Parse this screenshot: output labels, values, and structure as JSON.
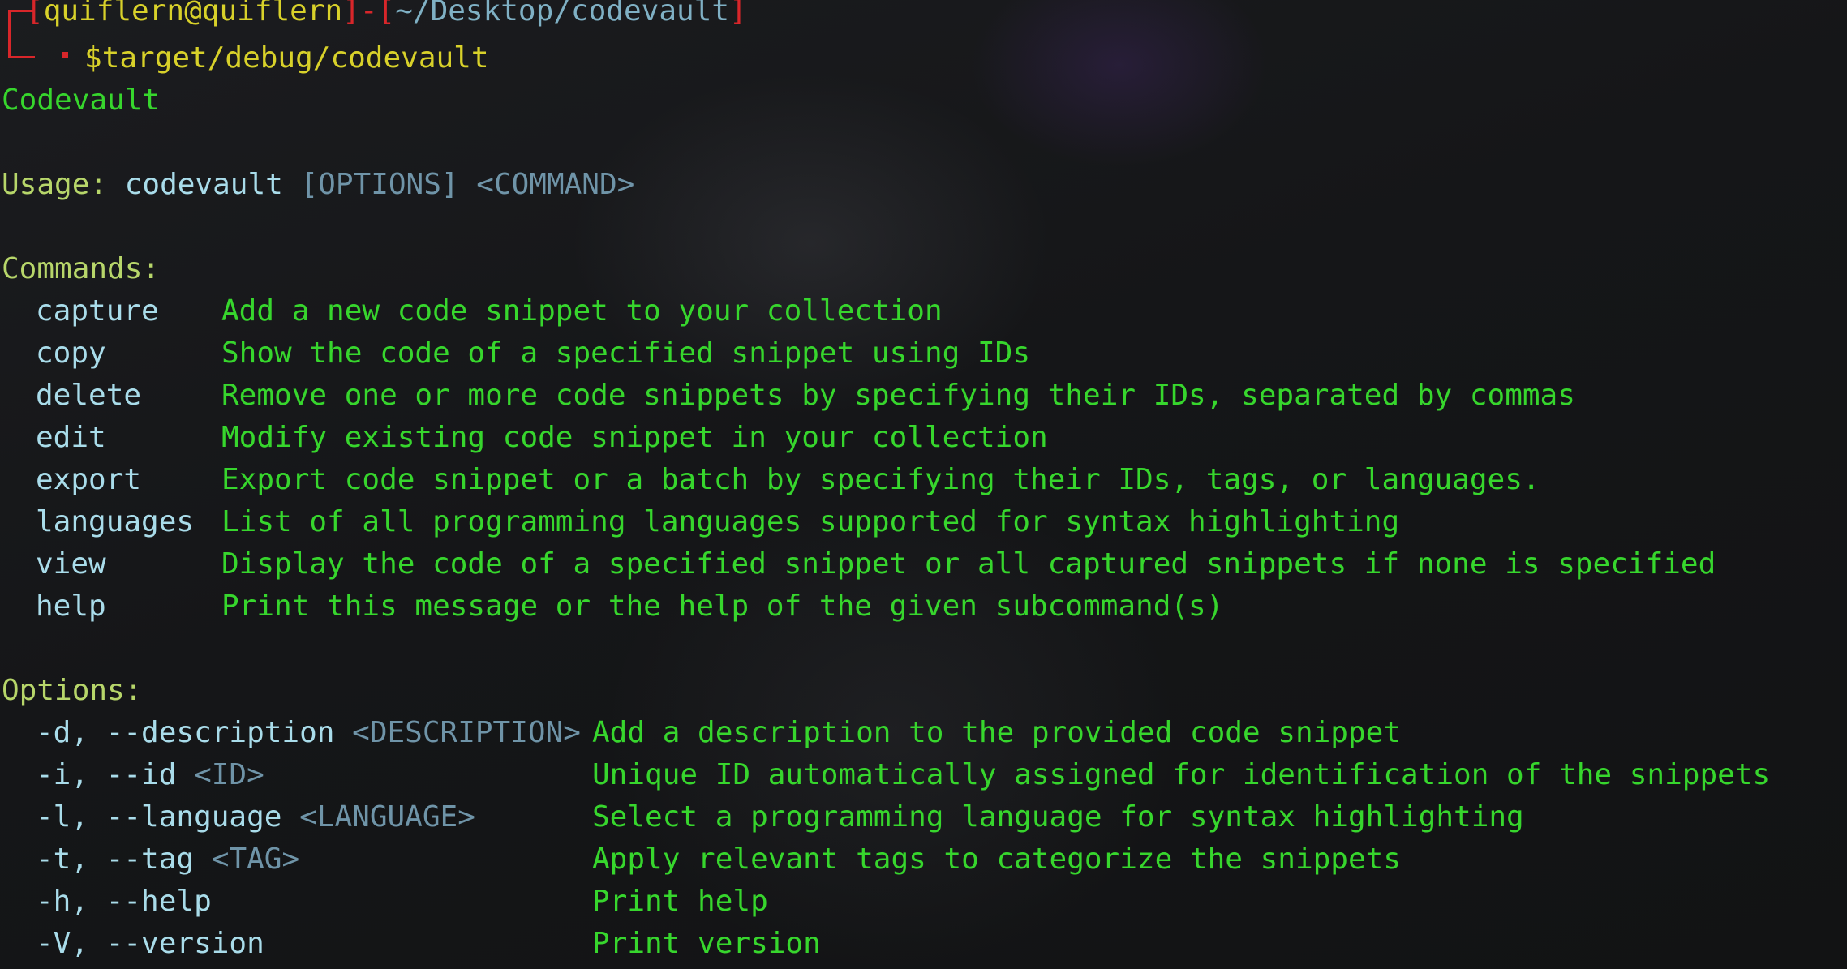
{
  "prompt": {
    "open_bracket": "[",
    "user": "quiflern",
    "at": "@",
    "host": "quiflern",
    "close_bracket": "]",
    "dash": "-",
    "path_open": "[",
    "path": "~/Desktop/codevault",
    "path_close": "]",
    "dollar": "$",
    "command": "target/debug/codevault"
  },
  "output": {
    "app_name": "Codevault",
    "usage_label": "Usage:",
    "usage_cmd": "codevault",
    "usage_options": "[OPTIONS]",
    "usage_command": "<COMMAND>",
    "commands_label": "Commands:",
    "commands": [
      {
        "name": "capture",
        "desc": "Add a new code snippet to your collection"
      },
      {
        "name": "copy",
        "desc": "Show the code of a specified snippet using IDs"
      },
      {
        "name": "delete",
        "desc": "Remove one or more code snippets by specifying their IDs, separated by commas"
      },
      {
        "name": "edit",
        "desc": "Modify existing code snippet in your collection"
      },
      {
        "name": "export",
        "desc": "Export code snippet or a batch by specifying their IDs, tags, or languages."
      },
      {
        "name": "languages",
        "desc": "List of all programming languages supported for syntax highlighting"
      },
      {
        "name": "view",
        "desc": "Display the code of a specified snippet or all captured snippets if none is specified"
      },
      {
        "name": "help",
        "desc": "Print this message or the help of the given subcommand(s)"
      }
    ],
    "options_label": "Options:",
    "options": [
      {
        "flags": "-d, --description",
        "arg": "<DESCRIPTION>",
        "desc": "Add a description to the provided code snippet"
      },
      {
        "flags": "-i, --id",
        "arg": "<ID>",
        "desc": "Unique ID automatically assigned for identification of the snippets"
      },
      {
        "flags": "-l, --language",
        "arg": "<LANGUAGE>",
        "desc": "Select a programming language for syntax highlighting"
      },
      {
        "flags": "-t, --tag",
        "arg": "<TAG>",
        "desc": "Apply relevant tags to categorize the snippets"
      },
      {
        "flags": "-h, --help",
        "arg": "",
        "desc": "Print help"
      },
      {
        "flags": "-V, --version",
        "arg": "",
        "desc": "Print version"
      }
    ]
  },
  "colors": {
    "prompt_red": "#d8262a",
    "prompt_user": "#d8d12a",
    "path": "#a9dcea",
    "command_name": "#a9dcea",
    "placeholder": "#6f94a8",
    "description": "#37d62d",
    "section_label": "#b7d66a",
    "background": "#151618"
  }
}
